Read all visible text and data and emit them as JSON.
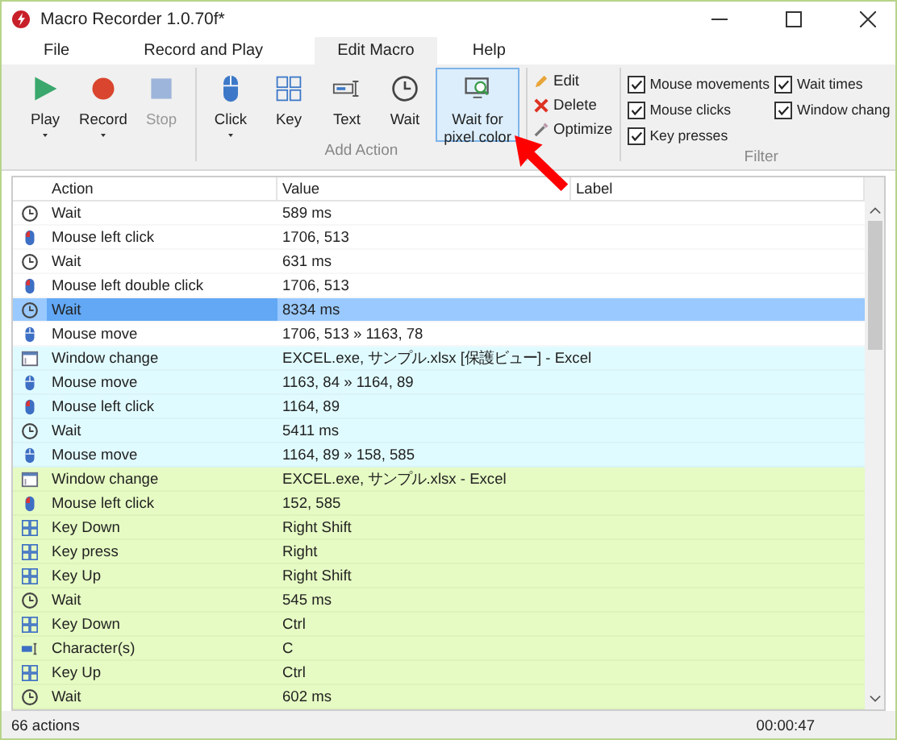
{
  "window": {
    "title": "Macro Recorder 1.0.70f*"
  },
  "tabs": [
    {
      "label": "File",
      "selected": false
    },
    {
      "label": "Record and Play",
      "selected": false
    },
    {
      "label": "Edit Macro",
      "selected": true
    },
    {
      "label": "Help",
      "selected": false
    }
  ],
  "ribbon": {
    "play_group": [
      {
        "kind": "play",
        "label": "Play",
        "dropdown": true,
        "disabled": false
      },
      {
        "kind": "record",
        "label": "Record",
        "dropdown": true,
        "disabled": false
      },
      {
        "kind": "stop",
        "label": "Stop",
        "dropdown": false,
        "disabled": true
      }
    ],
    "add_action": {
      "title": "Add Action",
      "buttons": [
        {
          "kind": "click",
          "label": "Click",
          "dropdown": true,
          "selected": false
        },
        {
          "kind": "key",
          "label": "Key",
          "dropdown": false,
          "selected": false
        },
        {
          "kind": "text",
          "label": "Text",
          "dropdown": false,
          "selected": false
        },
        {
          "kind": "wait",
          "label": "Wait",
          "dropdown": false,
          "selected": false
        },
        {
          "kind": "pixel",
          "label": "Wait for pixel color",
          "dropdown": false,
          "selected": true
        }
      ]
    },
    "edit_buttons": [
      {
        "kind": "edit",
        "label": "Edit"
      },
      {
        "kind": "delete",
        "label": "Delete"
      },
      {
        "kind": "optimize",
        "label": "Optimize"
      }
    ],
    "filter": {
      "title": "Filter",
      "options": [
        {
          "label": "Mouse movements",
          "checked": true
        },
        {
          "label": "Mouse clicks",
          "checked": true
        },
        {
          "label": "Key presses",
          "checked": true
        },
        {
          "label": "Wait times",
          "checked": true
        },
        {
          "label": "Window chang",
          "checked": true
        }
      ]
    }
  },
  "table": {
    "columns": [
      "Action",
      "Value",
      "Label"
    ],
    "rows": [
      {
        "kind": "wait",
        "action": "Wait",
        "value": "589 ms",
        "color": "#ffffff",
        "selected": false
      },
      {
        "kind": "click",
        "action": "Mouse left click",
        "value": "1706, 513",
        "color": "#ffffff",
        "selected": false
      },
      {
        "kind": "wait",
        "action": "Wait",
        "value": "631 ms",
        "color": "#ffffff",
        "selected": false
      },
      {
        "kind": "click",
        "action": "Mouse left double click",
        "value": "1706, 513",
        "color": "#ffffff",
        "selected": false
      },
      {
        "kind": "wait",
        "action": "Wait",
        "value": "8334 ms",
        "selected": true
      },
      {
        "kind": "move",
        "action": "Mouse move",
        "value": "1706, 513 » 1163, 78",
        "color": "#ffffff",
        "selected": false
      },
      {
        "kind": "window",
        "action": "Window change",
        "value": "EXCEL.exe, サンプル.xlsx  [保護ビュー] - Excel",
        "color": "#e0fbff",
        "selected": false
      },
      {
        "kind": "move",
        "action": "Mouse move",
        "value": "1163, 84 » 1164, 89",
        "color": "#e0fbff",
        "selected": false
      },
      {
        "kind": "click",
        "action": "Mouse left click",
        "value": "1164, 89",
        "color": "#e0fbff",
        "selected": false
      },
      {
        "kind": "wait",
        "action": "Wait",
        "value": "5411 ms",
        "color": "#e0fbff",
        "selected": false
      },
      {
        "kind": "move",
        "action": "Mouse move",
        "value": "1164, 89 » 158, 585",
        "color": "#e0fbff",
        "selected": false
      },
      {
        "kind": "window",
        "action": "Window change",
        "value": "EXCEL.exe, サンプル.xlsx - Excel",
        "color": "#e6fbc3",
        "selected": false
      },
      {
        "kind": "click",
        "action": "Mouse left click",
        "value": "152, 585",
        "color": "#e6fbc3",
        "selected": false
      },
      {
        "kind": "key",
        "action": "Key Down",
        "value": "Right Shift",
        "color": "#e6fbc3",
        "selected": false
      },
      {
        "kind": "key",
        "action": "Key press",
        "value": "Right",
        "color": "#e6fbc3",
        "selected": false
      },
      {
        "kind": "key",
        "action": "Key Up",
        "value": "Right Shift",
        "color": "#e6fbc3",
        "selected": false
      },
      {
        "kind": "wait",
        "action": "Wait",
        "value": "545 ms",
        "color": "#e6fbc3",
        "selected": false
      },
      {
        "kind": "key",
        "action": "Key Down",
        "value": "Ctrl",
        "color": "#e6fbc3",
        "selected": false
      },
      {
        "kind": "text",
        "action": "Character(s)",
        "value": "C",
        "color": "#e6fbc3",
        "selected": false
      },
      {
        "kind": "key",
        "action": "Key Up",
        "value": "Ctrl",
        "color": "#e6fbc3",
        "selected": false
      },
      {
        "kind": "wait",
        "action": "Wait",
        "value": "602 ms",
        "color": "#e6fbc3",
        "selected": false
      }
    ]
  },
  "status_bar": {
    "count": "66 actions",
    "time": "00:00:47"
  }
}
